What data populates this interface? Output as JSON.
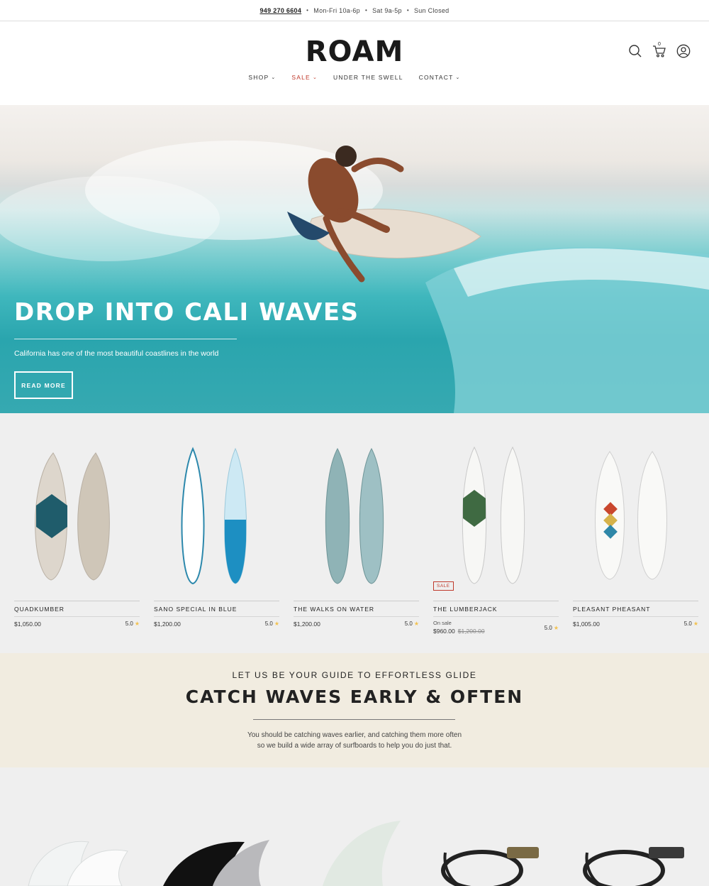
{
  "topbar": {
    "phone": "949 270 6604",
    "hours": [
      "Mon-Fri 10a-6p",
      "Sat 9a-5p",
      "Sun Closed"
    ],
    "separator": "•"
  },
  "header": {
    "logo": "ROAM",
    "nav": [
      {
        "label": "SHOP",
        "has_dropdown": true
      },
      {
        "label": "SALE",
        "has_dropdown": true
      },
      {
        "label": "UNDER THE SWELL",
        "has_dropdown": false
      },
      {
        "label": "CONTACT",
        "has_dropdown": true
      }
    ],
    "cart_count": "0",
    "icons": [
      "search-icon",
      "cart-icon",
      "account-icon"
    ],
    "sale_color": "#c0392b"
  },
  "hero": {
    "title": "DROP INTO CALI WAVES",
    "subtitle": "California has one of the most beautiful coastlines in the world",
    "button": "READ MORE"
  },
  "products": [
    {
      "name": "QUADKUMBER",
      "price": "$1,050.00",
      "rating": "5.0"
    },
    {
      "name": "SANO SPECIAL IN BLUE",
      "price": "$1,200.00",
      "rating": "5.0"
    },
    {
      "name": "THE WALKS ON WATER",
      "price": "$1,200.00",
      "rating": "5.0"
    },
    {
      "name": "THE LUMBERJACK",
      "badge": "SALE",
      "on_sale_label": "On sale",
      "price": "$960.00",
      "compare_price": "$1,200.00",
      "rating": "5.0"
    },
    {
      "name": "PLEASANT PHEASANT",
      "price": "$1,005.00",
      "rating": "5.0"
    }
  ],
  "rating_star": "★",
  "guide": {
    "eyebrow": "LET US BE YOUR GUIDE TO EFFORTLESS GLIDE",
    "title": "CATCH WAVES EARLY & OFTEN",
    "text_line1": "You should be catching waves earlier, and catching them more often",
    "text_line2": "so we build a wide array of surfboards to help you do just that."
  }
}
